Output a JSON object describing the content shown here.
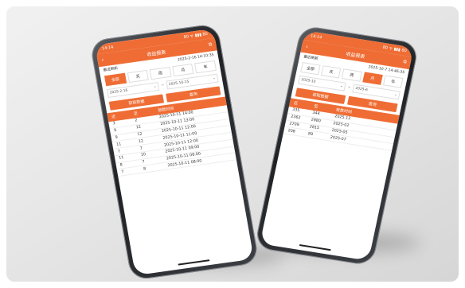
{
  "phone_left": {
    "status": {
      "time": "14:14",
      "indicators": "80 ᯤ ▮▮▮ 80"
    },
    "nav": {
      "title": "收益报表",
      "back": "‹",
      "action": "⧉"
    },
    "summary": {
      "label": "最近刷新",
      "value": "2025-2-16 14:10:35"
    },
    "tabs": [
      "全部",
      "天",
      "周",
      "月",
      "年"
    ],
    "active_tab": 0,
    "dates": {
      "from": "2025-2-16",
      "to": "2025-10-15"
    },
    "buttons": {
      "left": "获取数据",
      "right": "查询"
    },
    "table": {
      "headers": [
        "近",
        "至",
        "就数时间"
      ],
      "rows": [
        [
          "3",
          "2",
          "2025-10-11 14:00"
        ],
        [
          "9",
          "12",
          "2025-10-11 13:00"
        ],
        [
          "9",
          "12",
          "2025-10-11 12:00"
        ],
        [
          "11",
          "12",
          "2025-10-11 11:00"
        ],
        [
          "7",
          "7",
          "2025-10-11 12:00"
        ],
        [
          "11",
          "10",
          "2025-10-11 09:00"
        ],
        [
          "8",
          "7",
          "2025-10-11 08:00"
        ],
        [
          "7",
          "8",
          "2025-10-11 08:00"
        ]
      ]
    }
  },
  "phone_right": {
    "status": {
      "time": "14:14",
      "indicators": "80 ᯤ ▮▮▮ 80"
    },
    "nav": {
      "title": "收益报表",
      "back": "‹",
      "action": "⧉"
    },
    "summary": {
      "label": "最近刷新",
      "value": "2025-10-7 14:46:35"
    },
    "tabs": [
      "全部",
      "天",
      "周",
      "月",
      "年"
    ],
    "active_tab": 3,
    "dates": {
      "from": "2025-10",
      "to": "2025-6"
    },
    "buttons": {
      "left": "获取数据",
      "right": "查询"
    },
    "table": {
      "headers": [
        "近",
        "至",
        "就数时间"
      ],
      "rows": [
        [
          "335",
          "344",
          "2025-12"
        ],
        [
          "2362",
          "2880",
          "2025-02"
        ],
        [
          "2709",
          "2815",
          "2025-05"
        ],
        [
          "208",
          "89",
          "2025-07"
        ]
      ]
    }
  },
  "colors": {
    "accent": "#ef6d35"
  }
}
